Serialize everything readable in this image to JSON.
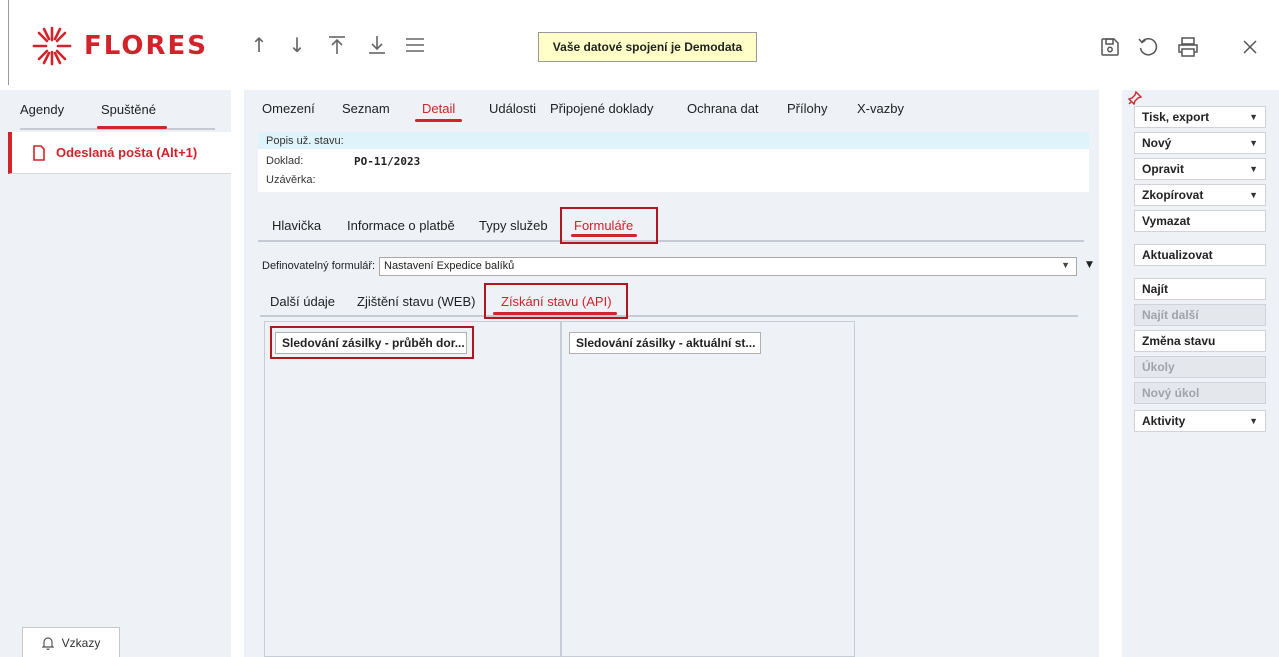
{
  "header": {
    "brand": "FLORES",
    "demo_banner": "Vaše datové spojení je Demodata",
    "nav_icons": [
      "arrow-up-icon",
      "arrow-down-icon",
      "arrow-to-top-icon",
      "arrow-to-bottom-icon",
      "menu-icon"
    ],
    "action_icons": [
      "save-icon",
      "undo-icon",
      "print-icon",
      "close-icon"
    ],
    "accent_color": "#d2232a"
  },
  "left": {
    "tabs": [
      {
        "label": "Agendy",
        "active": false
      },
      {
        "label": "Spuštěné",
        "active": true
      }
    ],
    "item": {
      "label": "Odeslaná pošta (Alt+1)",
      "icon": "document-icon"
    },
    "vzkazy": {
      "label": "Vzkazy",
      "icon": "bell-icon"
    }
  },
  "main": {
    "tabs": [
      {
        "label": "Omezení"
      },
      {
        "label": "Seznam"
      },
      {
        "label": "Detail",
        "active": true
      },
      {
        "label": "Události"
      },
      {
        "label": "Připojené doklady"
      },
      {
        "label": "Ochrana dat"
      },
      {
        "label": "Přílohy"
      },
      {
        "label": "X-vazby"
      }
    ],
    "info": {
      "popis_label": "Popis už. stavu:",
      "doklad_label": "Doklad:",
      "doklad_value": "PO-11/2023",
      "uzaverka_label": "Uzávěrka:"
    },
    "sub_tabs": [
      {
        "label": "Hlavička"
      },
      {
        "label": "Informace o platbě"
      },
      {
        "label": "Typy služeb"
      },
      {
        "label": "Formuláře",
        "active": true
      }
    ],
    "form": {
      "label": "Definovatelný formulář:",
      "value": "Nastavení Expedice balíků"
    },
    "inner_tabs": [
      {
        "label": "Další údaje"
      },
      {
        "label": "Zjištění stavu (WEB)"
      },
      {
        "label": "Získání stavu (API)",
        "active": true
      }
    ],
    "panels": [
      {
        "button": "Sledování zásilky - průběh dor..."
      },
      {
        "button": "Sledování zásilky - aktuální st..."
      }
    ]
  },
  "right": {
    "pin_icon": "pin-icon",
    "buttons": [
      {
        "label": "Tisk, export",
        "dropdown": true,
        "disabled": false
      },
      {
        "label": "Nový",
        "dropdown": true,
        "disabled": false
      },
      {
        "label": "Opravit",
        "dropdown": true,
        "disabled": false
      },
      {
        "label": "Zkopírovat",
        "dropdown": true,
        "disabled": false
      },
      {
        "label": "Vymazat",
        "dropdown": false,
        "disabled": false
      },
      {
        "label": "Aktualizovat",
        "dropdown": false,
        "disabled": false
      },
      {
        "label": "Najít",
        "dropdown": false,
        "disabled": false
      },
      {
        "label": "Najít další",
        "dropdown": false,
        "disabled": true
      },
      {
        "label": "Změna stavu",
        "dropdown": false,
        "disabled": false
      },
      {
        "label": "Úkoly",
        "dropdown": false,
        "disabled": true
      },
      {
        "label": "Nový úkol",
        "dropdown": false,
        "disabled": true
      },
      {
        "label": "Aktivity",
        "dropdown": true,
        "disabled": false
      }
    ]
  }
}
